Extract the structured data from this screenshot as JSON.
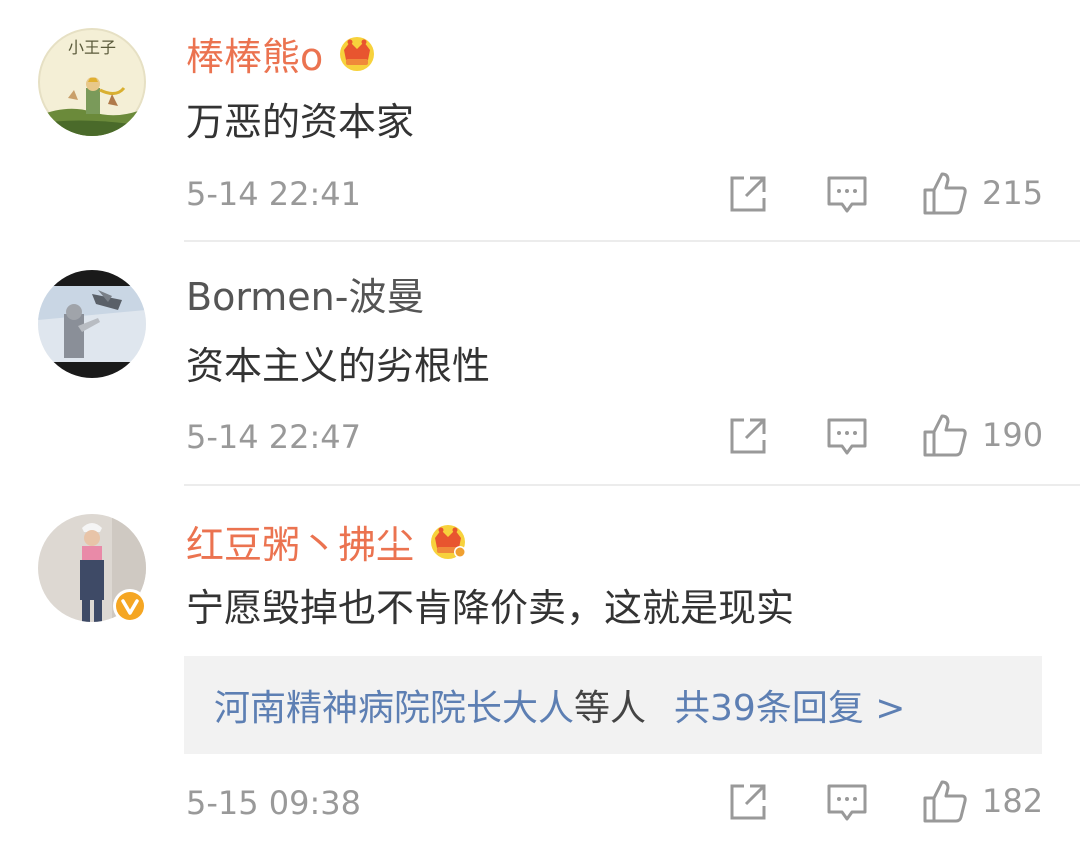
{
  "comments": [
    {
      "username": "棒棒熊o",
      "vip": true,
      "avatar_text": "小王子",
      "text": "万恶的资本家",
      "time": "5-14 22:41",
      "likes": "215"
    },
    {
      "username": "Bormen-波曼",
      "vip": false,
      "text": "资本主义的劣根性",
      "time": "5-14 22:47",
      "likes": "190"
    },
    {
      "username": "红豆粥丶拂尘",
      "vip": true,
      "verified": true,
      "text": "宁愿毁掉也不肯降价卖，这就是现实",
      "time": "5-15 09:38",
      "likes": "182",
      "replies": {
        "names": "河南精神病院院长大人",
        "etc": "等人",
        "total": "共39条回复 >"
      }
    }
  ],
  "icons": {
    "share": "share-icon",
    "comment": "comment-icon",
    "like": "thumbs-up-icon",
    "vip": "crown-icon",
    "verified": "verified-badge-icon"
  },
  "colors": {
    "vip_name": "#eb7350",
    "link": "#5d7fb3",
    "meta": "#999999",
    "verified_badge": "#f5a623"
  }
}
